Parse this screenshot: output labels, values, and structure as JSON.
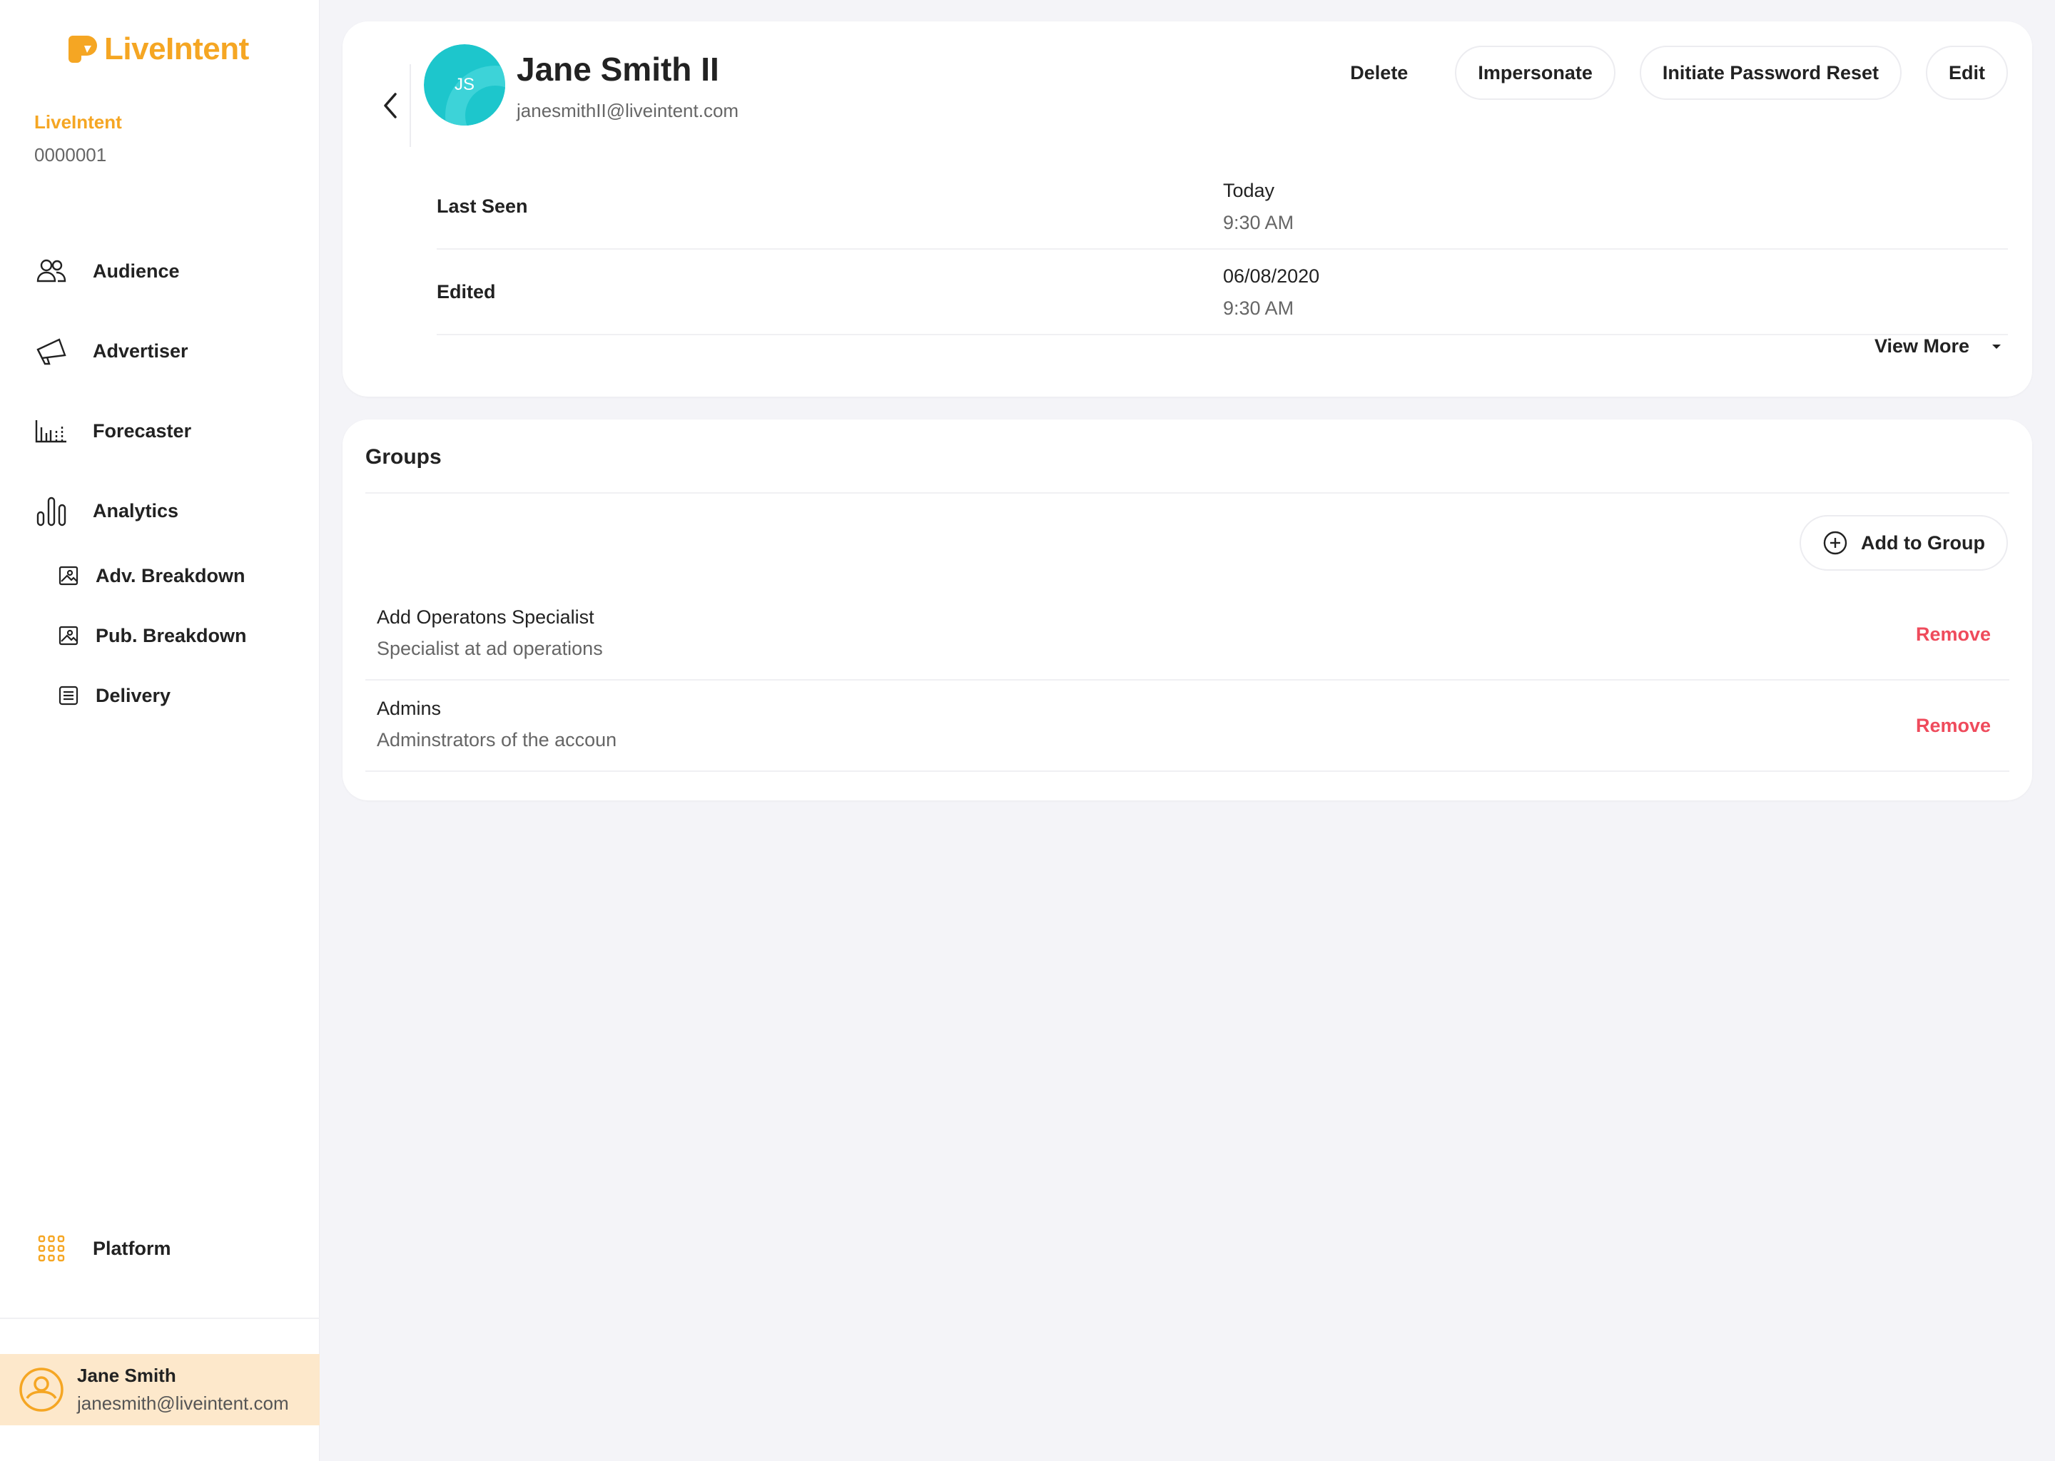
{
  "brand": {
    "name": "LiveIntent",
    "accent": "#f5a623"
  },
  "org": {
    "name": "LiveIntent",
    "id": "0000001"
  },
  "nav": {
    "items": [
      {
        "label": "Audience",
        "icon": "audience-icon"
      },
      {
        "label": "Advertiser",
        "icon": "megaphone-icon"
      },
      {
        "label": "Forecaster",
        "icon": "forecast-chart-icon"
      },
      {
        "label": "Analytics",
        "icon": "bar-chart-icon"
      }
    ],
    "sub_items": [
      {
        "label": "Adv. Breakdown",
        "icon": "image-icon"
      },
      {
        "label": "Pub. Breakdown",
        "icon": "image-icon"
      },
      {
        "label": "Delivery",
        "icon": "list-icon"
      }
    ],
    "platform": {
      "label": "Platform",
      "icon": "grid-icon"
    }
  },
  "current_user": {
    "name": "Jane Smith",
    "email": "janesmith@liveintent.com"
  },
  "profile": {
    "initials": "JS",
    "name": "Jane Smith II",
    "email": "janesmithII@liveintent.com",
    "avatar_color": "#1dc6cc",
    "actions": {
      "delete": "Delete",
      "impersonate": "Impersonate",
      "password_reset": "Initiate Password Reset",
      "edit": "Edit"
    },
    "details": [
      {
        "label": "Last Seen",
        "value_line1": "Today",
        "value_line2": "9:30 AM"
      },
      {
        "label": "Edited",
        "value_line1": "06/08/2020",
        "value_line2": "9:30 AM"
      }
    ],
    "view_more": "View More"
  },
  "groups": {
    "title": "Groups",
    "add_label": "Add to Group",
    "remove_color": "#ef4b5c",
    "items": [
      {
        "name": "Add Operatons Specialist",
        "description": "Specialist at ad operations",
        "action": "Remove"
      },
      {
        "name": "Admins",
        "description": "Adminstrators of the accoun",
        "action": "Remove"
      }
    ]
  }
}
